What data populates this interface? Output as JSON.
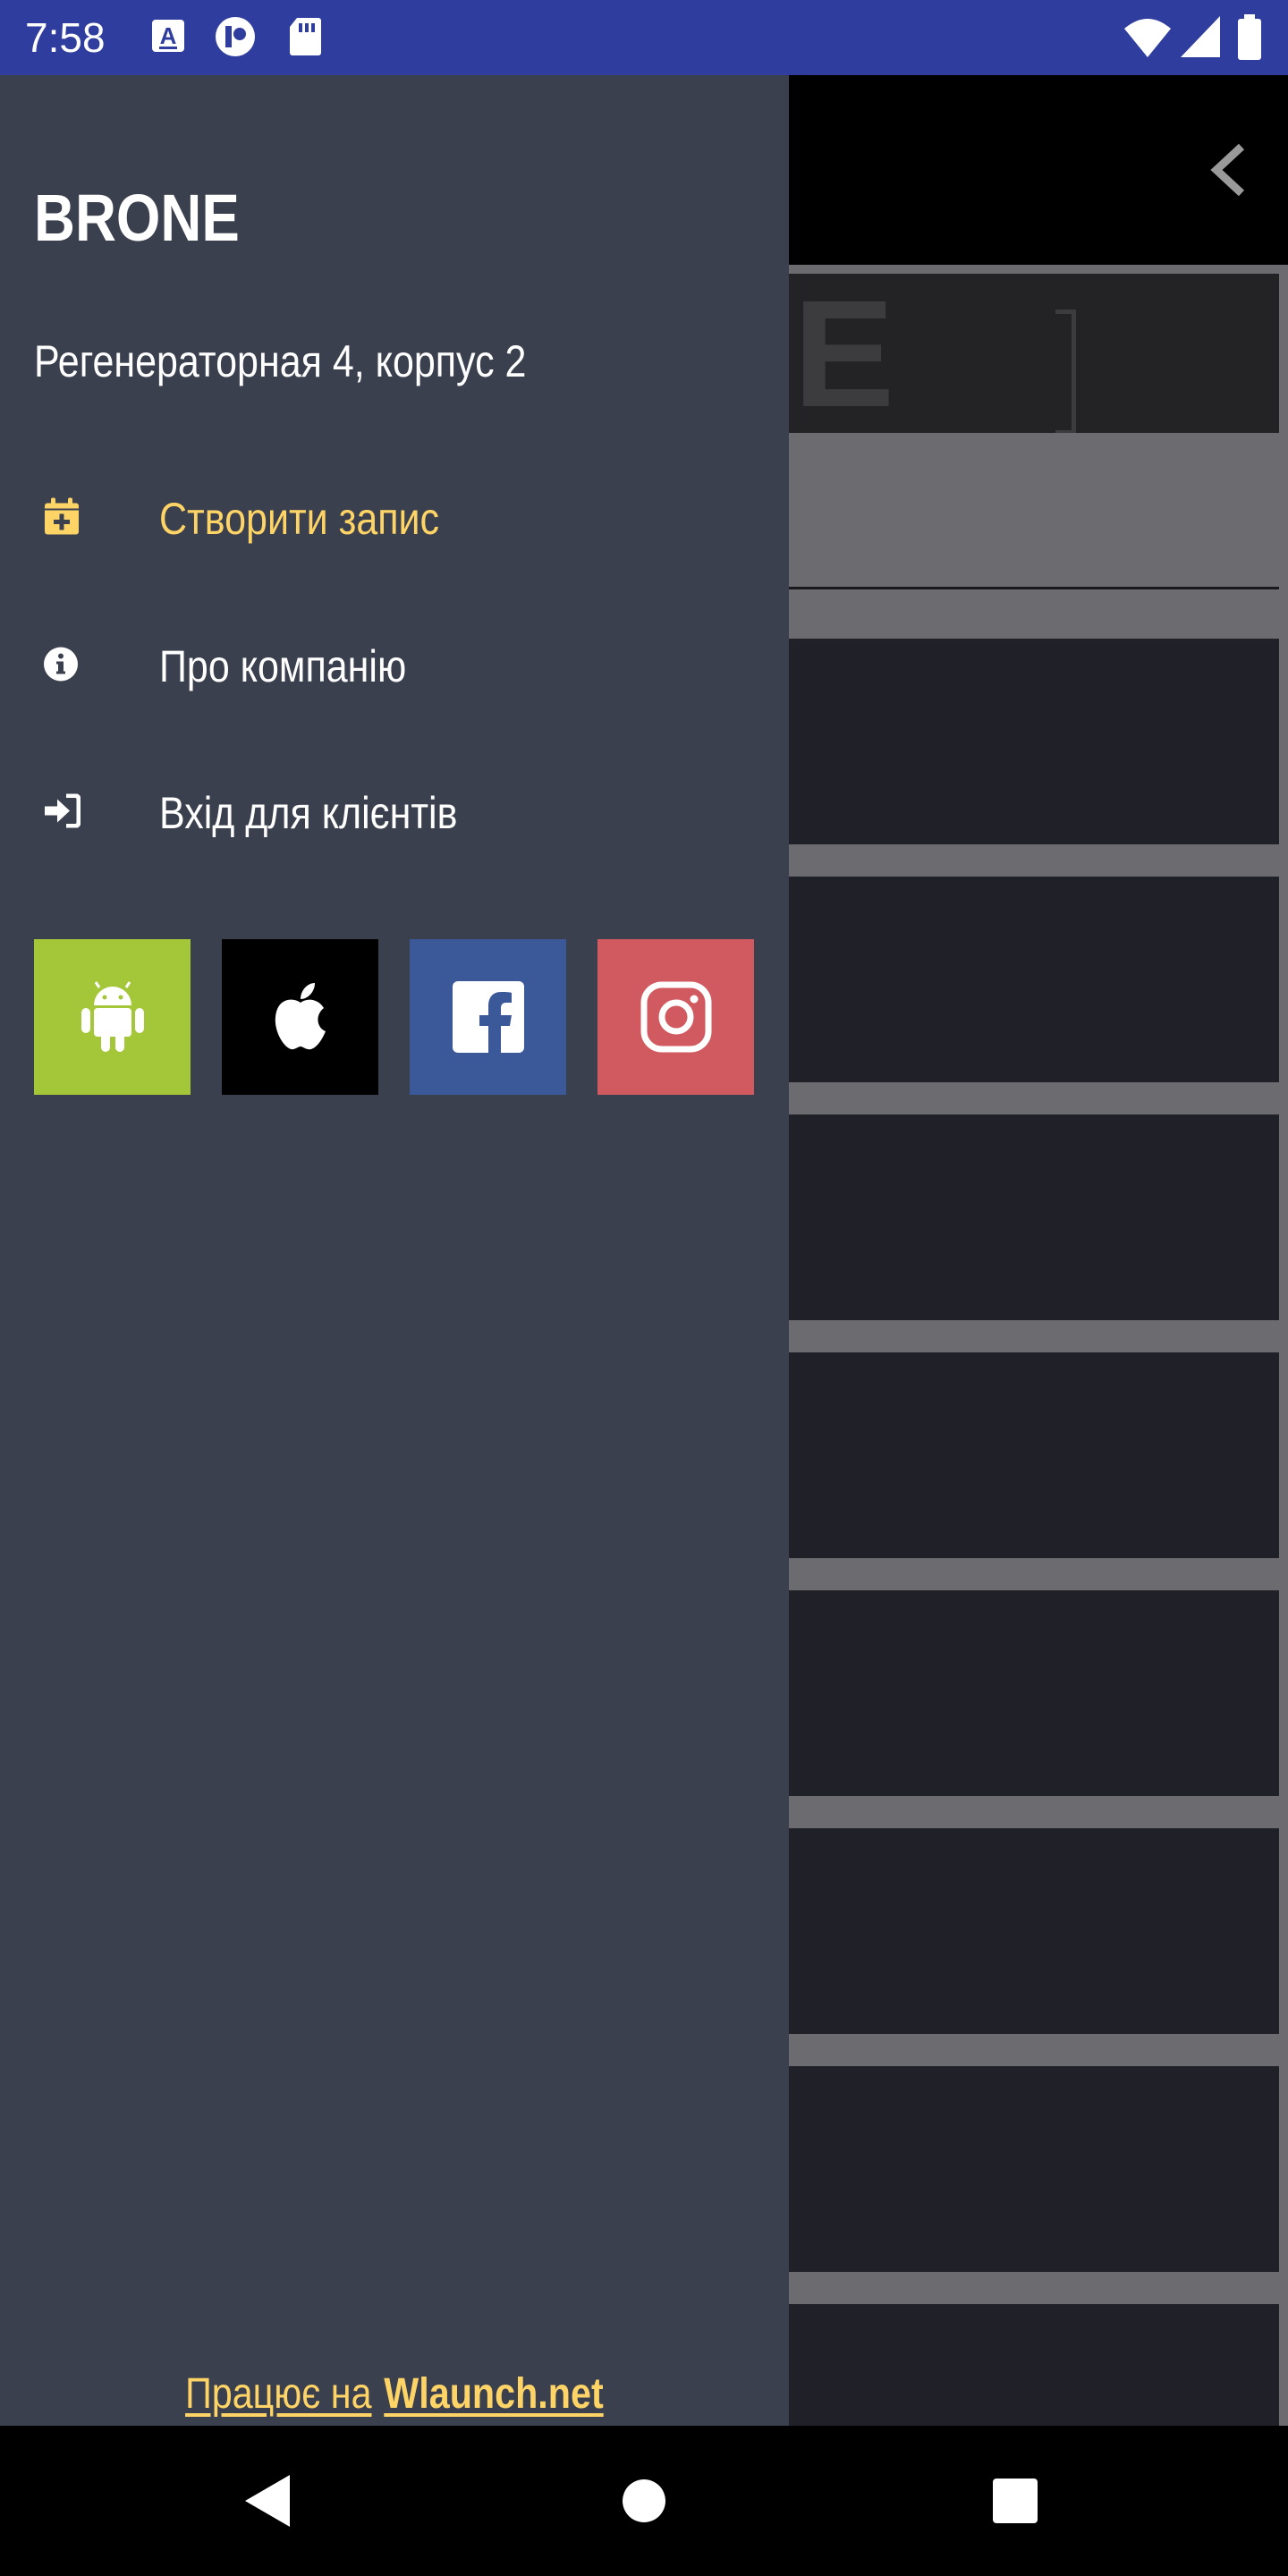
{
  "status_bar": {
    "time": "7:58",
    "notifications": [
      "a-keyboard-icon",
      "assistant-icon",
      "sd-card-icon"
    ],
    "indicators": [
      "wifi-icon",
      "signal-icon",
      "battery-icon"
    ]
  },
  "background_app": {
    "banner_text": "NE",
    "back_icon": "chevron-left-icon"
  },
  "drawer": {
    "title": "BRONE",
    "address": "Регенераторная 4, корпус 2",
    "menu": [
      {
        "label": "Створити запис",
        "icon": "calendar-plus-icon",
        "active": true
      },
      {
        "label": "Про компанію",
        "icon": "info-icon",
        "active": false
      },
      {
        "label": "Вхід для клієнтів",
        "icon": "sign-in-icon",
        "active": false
      }
    ],
    "social": [
      {
        "name": "android",
        "icon": "android-icon",
        "color": "#a4c639"
      },
      {
        "name": "apple",
        "icon": "apple-icon",
        "color": "#000000"
      },
      {
        "name": "facebook",
        "icon": "facebook-icon",
        "color": "#3b5998"
      },
      {
        "name": "instagram",
        "icon": "instagram-icon",
        "color": "#d05a5f"
      }
    ],
    "powered_prefix": "Працює на",
    "powered_link": "Wlaunch.net"
  },
  "colors": {
    "status_bar": "#2f3e9e",
    "drawer_bg": "#3b404e",
    "accent": "#fed466",
    "card_bg": "#1f2028"
  },
  "nav_bar": {
    "buttons": [
      "back-icon",
      "home-icon",
      "recents-icon"
    ]
  }
}
